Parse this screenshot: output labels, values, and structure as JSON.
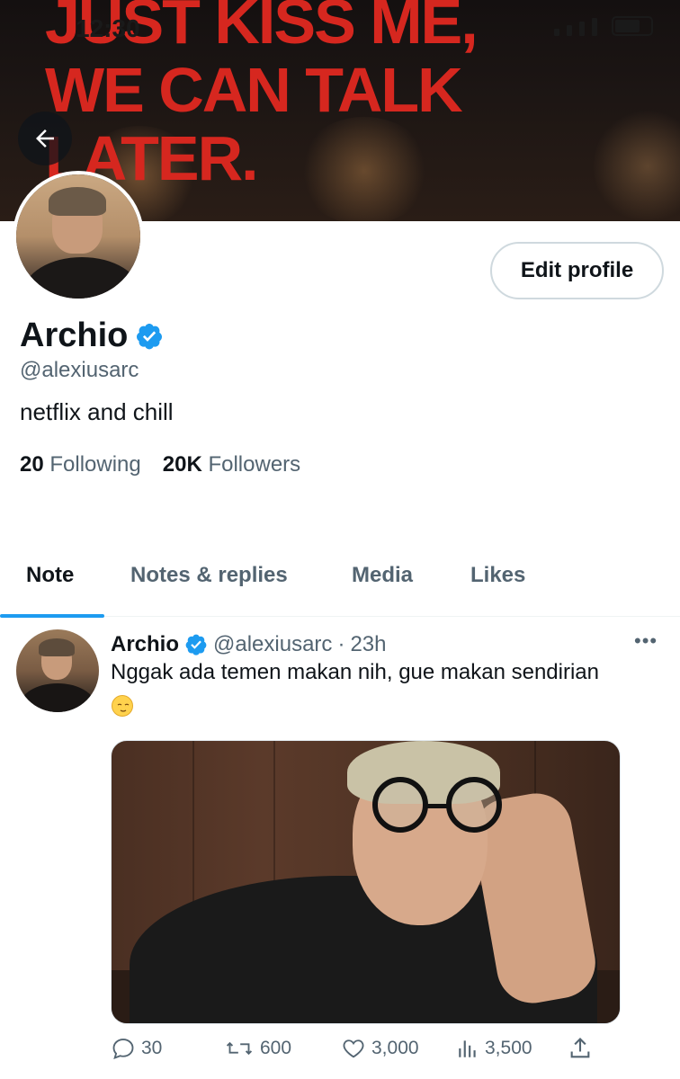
{
  "status_bar": {
    "time": "12:30"
  },
  "banner": {
    "text_lines": [
      "JUST KISS ME,",
      "WE CAN TALK",
      "LATER."
    ]
  },
  "profile": {
    "name": "Archio",
    "handle": "@alexiusarc",
    "bio": "netflix and chill",
    "following_count": "20",
    "following_label": "Following",
    "followers_count": "20K",
    "followers_label": "Followers",
    "edit_button": "Edit profile",
    "verified": true
  },
  "tabs": [
    {
      "label": "Note",
      "active": true
    },
    {
      "label": "Notes & replies",
      "active": false
    },
    {
      "label": "Media",
      "active": false
    },
    {
      "label": "Likes",
      "active": false
    }
  ],
  "post": {
    "author": "Archio",
    "handle": "@alexiusarc",
    "separator": "·",
    "time": "23h",
    "text": "Nggak ada temen makan nih, gue makan sendirian",
    "emoji": "relieved-face",
    "replies": "30",
    "reposts": "600",
    "likes": "3,000",
    "views": "3,500"
  },
  "colors": {
    "accent": "#1d9bf0",
    "banner_text": "#d6271f",
    "secondary_text": "#536471",
    "primary_text": "#0f1419"
  }
}
